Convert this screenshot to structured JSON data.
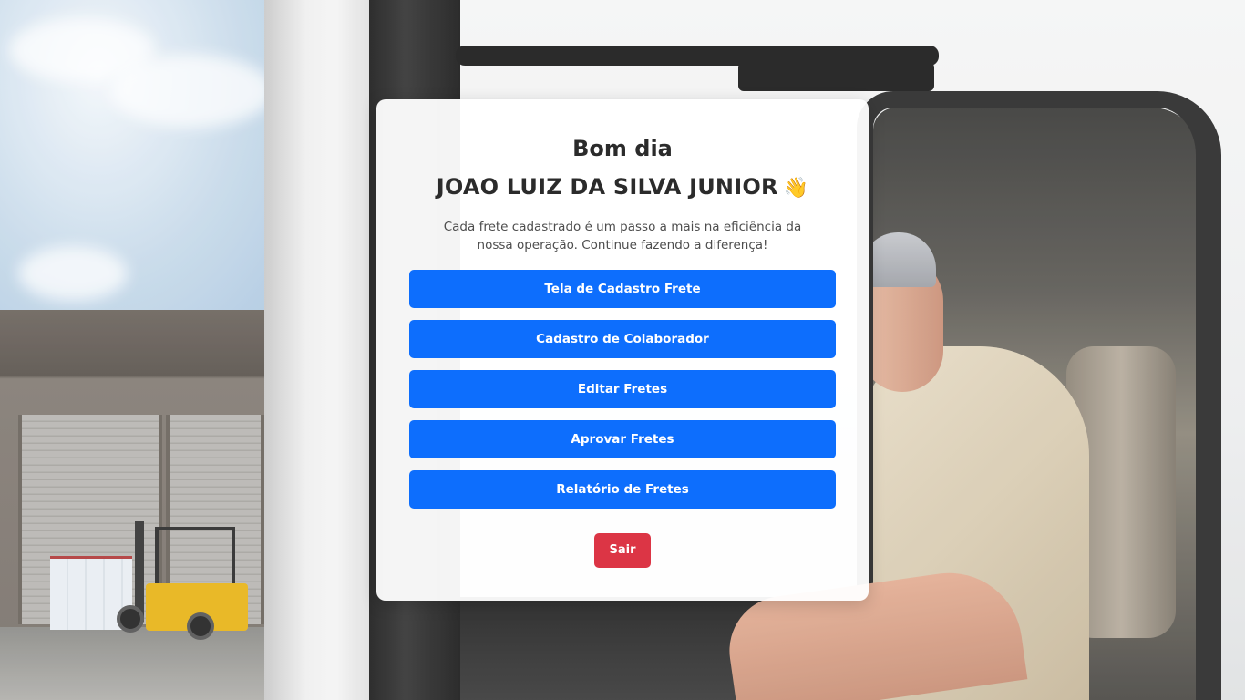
{
  "header": {
    "greeting": "Bom dia",
    "user_name": "JOAO LUIZ DA SILVA JUNIOR",
    "wave_emoji": "👋",
    "subtitle": "Cada frete cadastrado é um passo a mais na eficiência da nossa operação. Continue fazendo a diferença!"
  },
  "menu": {
    "items": [
      {
        "label": "Tela de Cadastro Frete"
      },
      {
        "label": "Cadastro de Colaborador"
      },
      {
        "label": "Editar Fretes"
      },
      {
        "label": "Aprovar Fretes"
      },
      {
        "label": "Relatório de Fretes"
      }
    ]
  },
  "actions": {
    "logout_label": "Sair"
  },
  "colors": {
    "primary": "#0d6efd",
    "danger": "#dc3545",
    "card_bg": "#ffffff"
  }
}
